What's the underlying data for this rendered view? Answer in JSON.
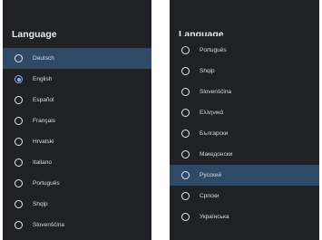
{
  "left_panel": {
    "title": "Language",
    "options": [
      {
        "label": "Deutsch",
        "checked": false,
        "selected": true
      },
      {
        "label": "English",
        "checked": true,
        "selected": false
      },
      {
        "label": "Español",
        "checked": false,
        "selected": false
      },
      {
        "label": "Français",
        "checked": false,
        "selected": false
      },
      {
        "label": "Hrvatski",
        "checked": false,
        "selected": false
      },
      {
        "label": "Italiano",
        "checked": false,
        "selected": false
      },
      {
        "label": "Português",
        "checked": false,
        "selected": false
      },
      {
        "label": "Shqip",
        "checked": false,
        "selected": false
      },
      {
        "label": "Slovenščina",
        "checked": false,
        "selected": false
      }
    ]
  },
  "right_panel": {
    "title": "Language",
    "options": [
      {
        "label": "Português",
        "checked": false,
        "selected": false
      },
      {
        "label": "Shqip",
        "checked": false,
        "selected": false
      },
      {
        "label": "Slovenščina",
        "checked": false,
        "selected": false
      },
      {
        "label": "Ελληνικά",
        "checked": false,
        "selected": false
      },
      {
        "label": "Български",
        "checked": false,
        "selected": false
      },
      {
        "label": "Македонски",
        "checked": false,
        "selected": false
      },
      {
        "label": "Русский",
        "checked": false,
        "selected": true
      },
      {
        "label": "Српски",
        "checked": false,
        "selected": false
      },
      {
        "label": "Українська",
        "checked": false,
        "selected": false
      }
    ]
  },
  "colors": {
    "panel_background": "#1f2124",
    "selected_row": "#2e4a66",
    "radio_checked": "#8ab4f8",
    "text": "#dadce0"
  }
}
